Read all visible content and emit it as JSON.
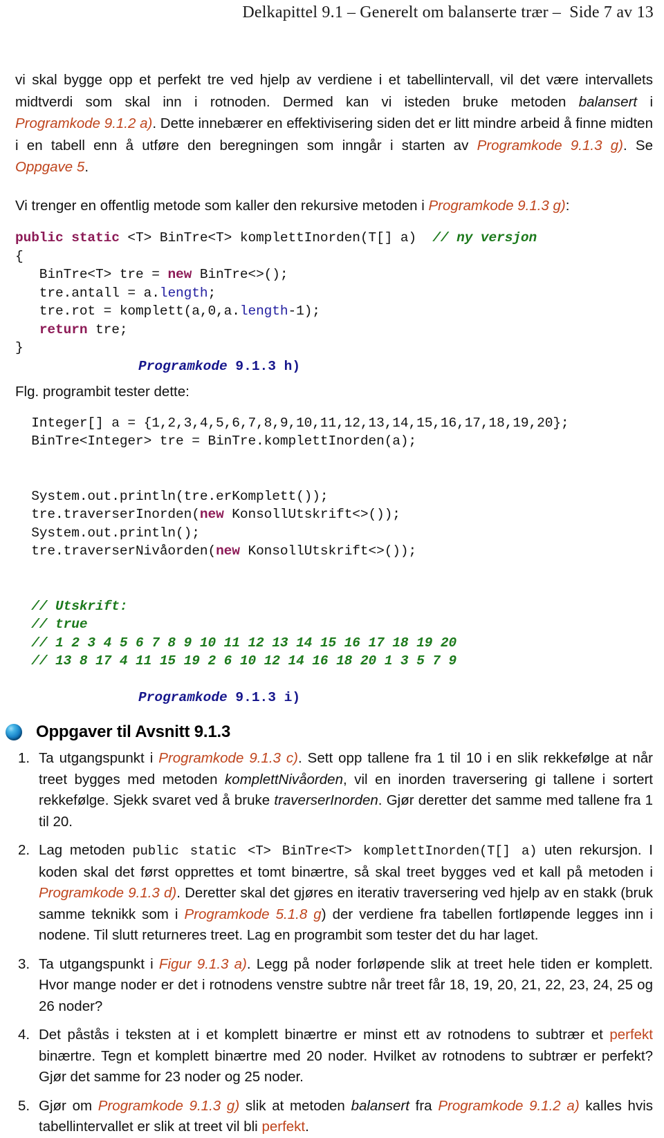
{
  "header": {
    "chapter": "Delkapittel 9.1",
    "dash1": "–",
    "title": "Generelt om balanserte trær",
    "dash2": "–",
    "page": "Side 7 av 13"
  },
  "colors": {
    "reference": "#bf441c",
    "caption": "#16168c",
    "keyword": "#8c1a56",
    "field": "#221fa0",
    "comment": "#1c7a1c",
    "text": "#111111",
    "bullet": "#1b86ca"
  },
  "paragraphs": {
    "p1": {
      "seg1": "vi skal bygge opp et perfekt tre ved hjelp av verdiene i et tabellintervall, vil det være intervallets midtverdi som skal inn i rotnoden. Dermed kan vi isteden bruke metoden ",
      "seg2_italic": "balansert",
      "seg3": " i ",
      "ref1": "Programkode 9.1.2 a)",
      "seg4": ". Dette innebærer en effektivisering siden det er litt mindre arbeid å finne midten i en tabell enn å utføre den beregningen som inngår i starten av ",
      "ref2": "Programkode 9.1.3 g)",
      "seg5": ". Se ",
      "ref3": "Oppgave 5",
      "seg6": "."
    },
    "p2": {
      "seg1": "Vi trenger en offentlig metode som kaller den rekursive metoden i ",
      "ref1": "Programkode 9.1.3 g)",
      "seg2": ":"
    },
    "p3": "Flg. programbit tester dette:"
  },
  "code_block_1": {
    "lines": [
      {
        "parts": [
          {
            "t": "public static",
            "c": "kw"
          },
          {
            "t": " <T> BinTre<T> komplettInorden(T[] a)  ",
            "c": ""
          },
          {
            "t": "// ny versjon",
            "c": "cmt"
          }
        ]
      },
      {
        "parts": [
          {
            "t": "{",
            "c": ""
          }
        ]
      },
      {
        "parts": [
          {
            "t": "   BinTre<T> tre = ",
            "c": ""
          },
          {
            "t": "new",
            "c": "kw"
          },
          {
            "t": " BinTre<>();",
            "c": ""
          }
        ]
      },
      {
        "parts": [
          {
            "t": "   tre.antall = a.",
            "c": ""
          },
          {
            "t": "length",
            "c": "fld"
          },
          {
            "t": ";",
            "c": ""
          }
        ]
      },
      {
        "parts": [
          {
            "t": "   tre.rot = komplett(a,0,a.",
            "c": ""
          },
          {
            "t": "length",
            "c": "fld"
          },
          {
            "t": "-1);",
            "c": ""
          }
        ]
      },
      {
        "parts": [
          {
            "t": "   ",
            "c": ""
          },
          {
            "t": "return",
            "c": "kw"
          },
          {
            "t": " tre;",
            "c": ""
          }
        ]
      },
      {
        "parts": [
          {
            "t": "}",
            "c": ""
          }
        ]
      }
    ],
    "caption_label": "Programkode",
    "caption_num": " 9.1.3 h)"
  },
  "code_block_2": {
    "lines": [
      {
        "parts": [
          {
            "t": "  Integer[] a = {1,2,3,4,5,6,7,8,9,10,11,12,13,14,15,16,17,18,19,20};",
            "c": ""
          }
        ]
      },
      {
        "parts": [
          {
            "t": "  BinTre<Integer> tre = BinTre.komplettInorden(a);",
            "c": ""
          }
        ]
      },
      {
        "parts": [
          {
            "t": "",
            "c": ""
          }
        ]
      },
      {
        "parts": [
          {
            "t": "",
            "c": ""
          }
        ]
      },
      {
        "parts": [
          {
            "t": "  System.out.println(tre.erKomplett());",
            "c": ""
          }
        ]
      },
      {
        "parts": [
          {
            "t": "  tre.traverserInorden(",
            "c": ""
          },
          {
            "t": "new",
            "c": "kw"
          },
          {
            "t": " KonsollUtskrift<>());",
            "c": ""
          }
        ]
      },
      {
        "parts": [
          {
            "t": "  System.out.println();",
            "c": ""
          }
        ]
      },
      {
        "parts": [
          {
            "t": "  tre.traverserNivåorden(",
            "c": ""
          },
          {
            "t": "new",
            "c": "kw"
          },
          {
            "t": " KonsollUtskrift<>());",
            "c": ""
          }
        ]
      },
      {
        "parts": [
          {
            "t": "",
            "c": ""
          }
        ]
      },
      {
        "parts": [
          {
            "t": "",
            "c": ""
          }
        ]
      },
      {
        "parts": [
          {
            "t": "  // Utskrift:",
            "c": "cmt"
          }
        ]
      },
      {
        "parts": [
          {
            "t": "  // true",
            "c": "cmt"
          }
        ]
      },
      {
        "parts": [
          {
            "t": "  // 1 2 3 4 5 6 7 8 9 10 11 12 13 14 15 16 17 18 19 20",
            "c": "cmt"
          }
        ]
      },
      {
        "parts": [
          {
            "t": "  // 13 8 17 4 11 15 19 2 6 10 12 14 16 18 20 1 3 5 7 9",
            "c": "cmt"
          }
        ]
      }
    ],
    "caption_label": "Programkode",
    "caption_num": " 9.1.3 i)",
    "output": {
      "header_comment": "// Utskrift:",
      "erKomplett": "true",
      "inorden": [
        1,
        2,
        3,
        4,
        5,
        6,
        7,
        8,
        9,
        10,
        11,
        12,
        13,
        14,
        15,
        16,
        17,
        18,
        19,
        20
      ],
      "nivaaorden": [
        13,
        8,
        17,
        4,
        11,
        15,
        19,
        2,
        6,
        10,
        12,
        14,
        16,
        18,
        20,
        1,
        3,
        5,
        7,
        9
      ],
      "input_array": [
        1,
        2,
        3,
        4,
        5,
        6,
        7,
        8,
        9,
        10,
        11,
        12,
        13,
        14,
        15,
        16,
        17,
        18,
        19,
        20
      ]
    }
  },
  "oppgaver": {
    "bullet_icon": "blue-sphere-bullet",
    "title": "Oppgaver til Avsnitt 9.1.3",
    "items": [
      {
        "a": "Ta utgangspunkt i ",
        "ref1": "Programkode 9.1.3 c)",
        "b": ". Sett opp tallene fra 1 til 10 i en slik rekkefølge at når treet bygges med metoden ",
        "it1": "komplettNivåorden",
        "c": ", vil en inorden traversering gi tallene i sortert rekkefølge. Sjekk svaret ved å bruke ",
        "it2": "traverserInorden",
        "d": ". Gjør deretter det samme med tallene fra 1 til 20."
      },
      {
        "a": "Lag metoden ",
        "code1": "public static <T> BinTre<T> komplettInorden(T[] a)",
        "b": " uten rekursjon. I koden skal det først opprettes et tomt binærtre, så skal treet bygges ved et kall på metoden i ",
        "ref1": "Programkode 9.1.3 d)",
        "c": ". Deretter skal det gjøres en iterativ traversering ved hjelp av en stakk (bruk samme teknikk som i ",
        "ref2": "Programkode 5.1.8 g",
        "d": ") der verdiene fra tabellen fortløpende legges inn i nodene. Til slutt returneres treet. Lag en programbit som tester det du har laget."
      },
      {
        "a": "Ta utgangspunkt i ",
        "ref1": "Figur 9.1.3 a)",
        "b": ". Legg på noder forløpende slik at treet hele tiden er komplett. Hvor mange noder er det i rotnodens venstre subtre når treet får 18, 19, 20, 21, 22, 23, 24, 25 og 26 noder?"
      },
      {
        "a": "Det påstås i teksten at i et komplett binærtre er minst ett av rotnodens to subtrær et ",
        "hl1": "perfekt",
        "b": " binærtre. Tegn et komplett binærtre med 20 noder. Hvilket av rotnodens to subtrær er perfekt? Gjør det samme for 23 noder og 25 noder."
      },
      {
        "a": "Gjør om ",
        "ref1": "Programkode 9.1.3 g)",
        "b": " slik at metoden ",
        "it1": "balansert",
        "c": " fra ",
        "ref2": "Programkode 9.1.2 a)",
        "d": " kalles hvis tabellintervallet er slik at treet vil bli ",
        "hl1": "perfekt",
        "e": "."
      }
    ]
  }
}
